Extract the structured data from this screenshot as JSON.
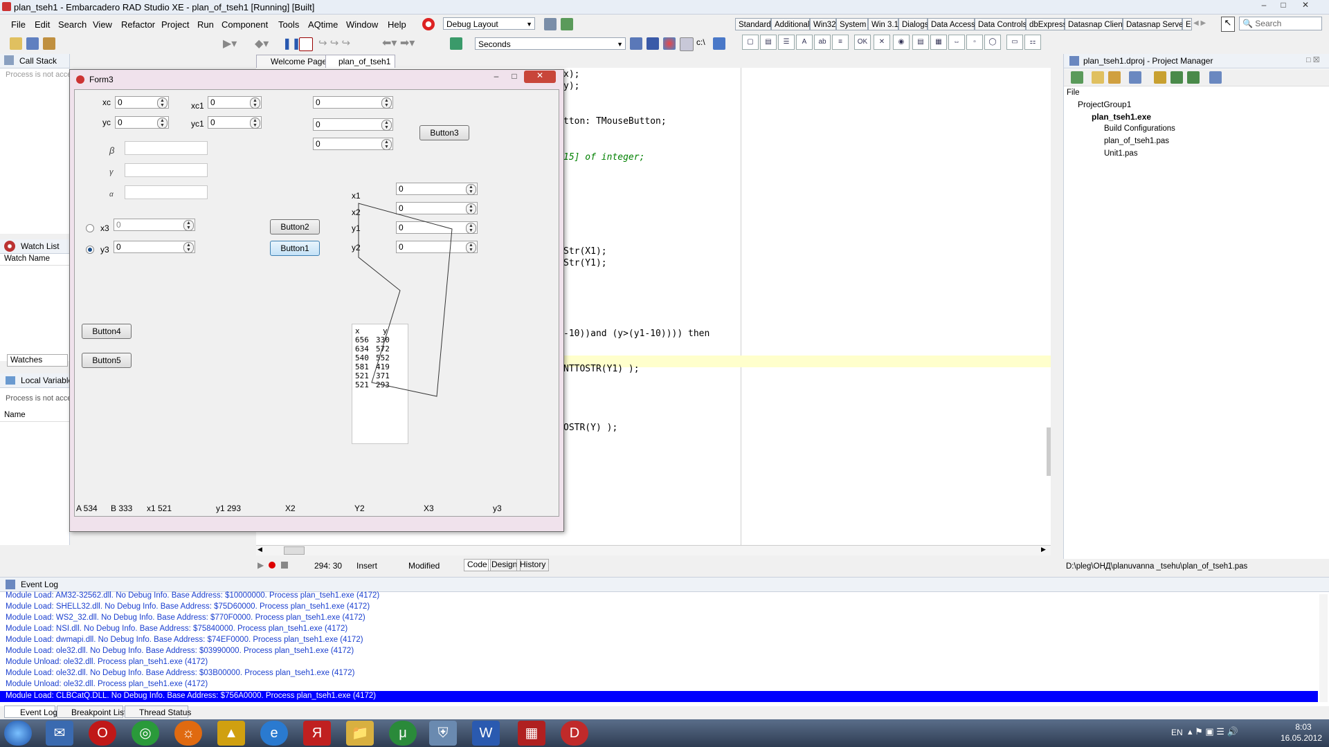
{
  "window": {
    "title": "plan_tseh1 - Embarcadero RAD Studio XE - plan_of_tseh1 [Running] [Built]"
  },
  "menu": [
    "File",
    "Edit",
    "Search",
    "View",
    "Refactor",
    "Project",
    "Run",
    "Component",
    "Tools",
    "AQtime",
    "Window",
    "Help"
  ],
  "toolbar": {
    "layout_combo": "Debug Layout",
    "seconds_combo": "Seconds"
  },
  "palette": {
    "tabs": [
      "Standard",
      "Additional",
      "Win32",
      "System",
      "Win 3.1",
      "Dialogs",
      "Data Access",
      "Data Controls",
      "dbExpress",
      "Datasnap Client",
      "Datasnap Server",
      "E"
    ],
    "search_placeholder": "Search"
  },
  "left_panels": {
    "call_stack": {
      "title": "Call Stack",
      "msg": "Process is not acce"
    },
    "watch_list": {
      "title": "Watch List",
      "col": "Watch Name",
      "tab": "Watches"
    },
    "local_vars": {
      "title": "Local Variables",
      "msg": "Process is not acce",
      "col": "Name"
    }
  },
  "editor": {
    "tabs": [
      "Welcome Page",
      "plan_of_tseh1"
    ],
    "lines": [
      {
        "text": "x);"
      },
      {
        "text": "y);"
      },
      {
        "text": "tton: TMouseButton;"
      },
      {
        "text": "15] of integer;"
      },
      {
        "text": "Str(X1);"
      },
      {
        "text": "Str(Y1);"
      },
      {
        "text": "-10))and (y>(y1-10)))) then"
      },
      {
        "text": "NTTOSTR(Y1) );"
      },
      {
        "text": "OSTR(Y) );"
      }
    ],
    "status": {
      "pos": "294: 30",
      "mode": "Insert",
      "state": "Modified"
    },
    "view_tabs": [
      "Code",
      "Design",
      "History"
    ]
  },
  "form3": {
    "title": "Form3",
    "labels": {
      "xc": "xc",
      "yc": "yc",
      "xc1": "xc1",
      "yc1": "yc1",
      "beta": "β",
      "gamma": "γ",
      "alpha": "α",
      "x3": "x3",
      "y3": "y3",
      "x1": "x1",
      "x2": "x2",
      "y1": "y1",
      "y2": "y2"
    },
    "spins": {
      "xc": "0",
      "yc": "0",
      "xc1": "0",
      "yc1": "0",
      "top1": "0",
      "top2": "0",
      "top3": "0",
      "x3": "0",
      "y3": "0",
      "x1": "0",
      "x2": "0",
      "y1": "0",
      "y2": "0"
    },
    "buttons": {
      "b1": "Button1",
      "b2": "Button2",
      "b3": "Button3",
      "b4": "Button4",
      "b5": "Button5"
    },
    "memo": {
      "header": [
        "x",
        "y"
      ],
      "rows": [
        [
          "656",
          "330"
        ],
        [
          "634",
          "572"
        ],
        [
          "540",
          "552"
        ],
        [
          "581",
          "419"
        ],
        [
          "521",
          "371"
        ],
        [
          "521",
          "293"
        ]
      ]
    },
    "status": [
      "A  534",
      "B  333",
      "x1  521",
      "y1  293",
      "X2",
      "Y2",
      "X3",
      "y3"
    ]
  },
  "project_manager": {
    "title": "plan_tseh1.dproj - Project Manager",
    "file_label": "File",
    "tree": [
      "ProjectGroup1",
      "plan_tseh1.exe",
      "Build Configurations",
      "plan_of_tseh1.pas",
      "Unit1.pas"
    ],
    "path": "D:\\pleg\\ОНД\\planuvanna _tsehu\\plan_of_tseh1.pas"
  },
  "event_log": {
    "title": "Event Log",
    "lines": [
      "Module Load: AM32-32562.dll. No Debug Info. Base Address: $10000000. Process plan_tseh1.exe (4172)",
      "Module Load: SHELL32.dll. No Debug Info. Base Address: $75D60000. Process plan_tseh1.exe (4172)",
      "Module Load: WS2_32.dll. No Debug Info. Base Address: $770F0000. Process plan_tseh1.exe (4172)",
      "Module Load: NSI.dll. No Debug Info. Base Address: $75840000. Process plan_tseh1.exe (4172)",
      "Module Load: dwmapi.dll. No Debug Info. Base Address: $74EF0000. Process plan_tseh1.exe (4172)",
      "Module Load: ole32.dll. No Debug Info. Base Address: $03990000. Process plan_tseh1.exe (4172)",
      "Module Unload: ole32.dll. Process plan_tseh1.exe (4172)",
      "Module Load: ole32.dll. No Debug Info. Base Address: $03B00000. Process plan_tseh1.exe (4172)",
      "Module Unload: ole32.dll. Process plan_tseh1.exe (4172)",
      "Module Load: CLBCatQ.DLL. No Debug Info. Base Address: $756A0000. Process plan_tseh1.exe (4172)"
    ],
    "tabs": [
      "Event Log",
      "Breakpoint List",
      "Thread Status"
    ]
  },
  "taskbar": {
    "lang": "EN",
    "time": "8:03",
    "date": "16.05.2012"
  }
}
